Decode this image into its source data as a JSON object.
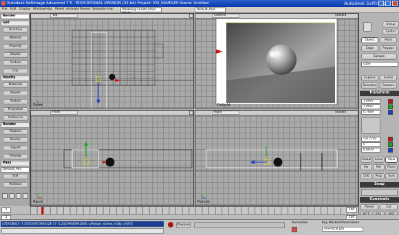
{
  "window": {
    "title": "Autodesk Softimage Advanced 7.5 - EDUCATIONAL VERSION (32-bit)    Project: XSI_SAMPLES    Scene: Untitled",
    "brand": "Autodesk Softimage"
  },
  "menu": {
    "items": [
      "File",
      "Edit",
      "Display",
      "Window",
      "Help",
      "Model",
      "Animate",
      "Render",
      "Simulate",
      "Hair"
    ],
    "construction_mode": "Modeling Construction Mode",
    "pass": "Default_Pass"
  },
  "left_toolbar": {
    "module": "Render",
    "sections": [
      {
        "label": "Get",
        "buttons": [
          "Primitive",
          "Material",
          "Property",
          "Shader",
          "Texture",
          "Clip"
        ]
      },
      {
        "label": "Modify",
        "buttons": [
          "Materials",
          "Shader",
          "Texture",
          "Projection",
          "Ambience"
        ]
      },
      {
        "label": "Render",
        "buttons": [
          "Regions",
          "Render",
          "Export",
          "Preview"
        ]
      },
      {
        "label": "Pass",
        "buttons": [
          "Edit",
          "Partition"
        ]
      }
    ],
    "pass_value": "Default_Pas"
  },
  "viewports": {
    "top": {
      "title": "Top",
      "view": "Shaded",
      "label": "Res≋"
    },
    "camera": {
      "title": "Camera",
      "view": "Shaded",
      "label": "Relight"
    },
    "front": {
      "title": "Front",
      "view": "Shaded",
      "label": "Res≋"
    },
    "right": {
      "title": "Right",
      "view": "Shaded",
      "label": "Persist"
    }
  },
  "right_panel": {
    "selection": {
      "top": [
        "Group",
        "Center"
      ],
      "object_row": [
        "Object",
        "Point"
      ],
      "row2": [
        "Edge",
        "Polygon"
      ],
      "sample": "Sample"
    },
    "object_name": "cube",
    "explore_row": [
      "Explore",
      "Scene"
    ],
    "selection_row": [
      "Selection",
      "Clusters"
    ],
    "transform_title": "Transform",
    "scale": [
      "1.0097",
      "1.0097",
      "0.7609"
    ],
    "translate": [
      "-14.7702",
      "0",
      "0.6979"
    ],
    "ref_row": [
      "Global",
      "Local",
      "View"
    ],
    "par_row": [
      "Par",
      "Ref",
      "Plane"
    ],
    "cog_row": [
      "COG",
      "Prop",
      "Sym"
    ],
    "snap_title": "Snap",
    "constrain_title": "Constrain",
    "parent_row": [
      "Parent",
      "Cut"
    ],
    "mcp_row": [
      "MCP",
      "KP/L",
      "MAT"
    ]
  },
  "timeline": {
    "start": "1",
    "end": "100",
    "current": "1",
    "end_field": "100"
  },
  "status": {
    "text": "4719.08014 -7.54722697392032E-17 -1.23259640941844; x/Relabe: sh/iew; s/Obj; s/rXYZ",
    "playback": "Playback",
    "animation": "Animation",
    "key_marked": "Key Marked Parameters",
    "field": "sine-local.pos"
  },
  "colors": {
    "selection_red": "#cc1111",
    "axis_blue": "#1a3fd0",
    "axis_green": "#17a717",
    "highlight_yellow": "#e0e020"
  }
}
